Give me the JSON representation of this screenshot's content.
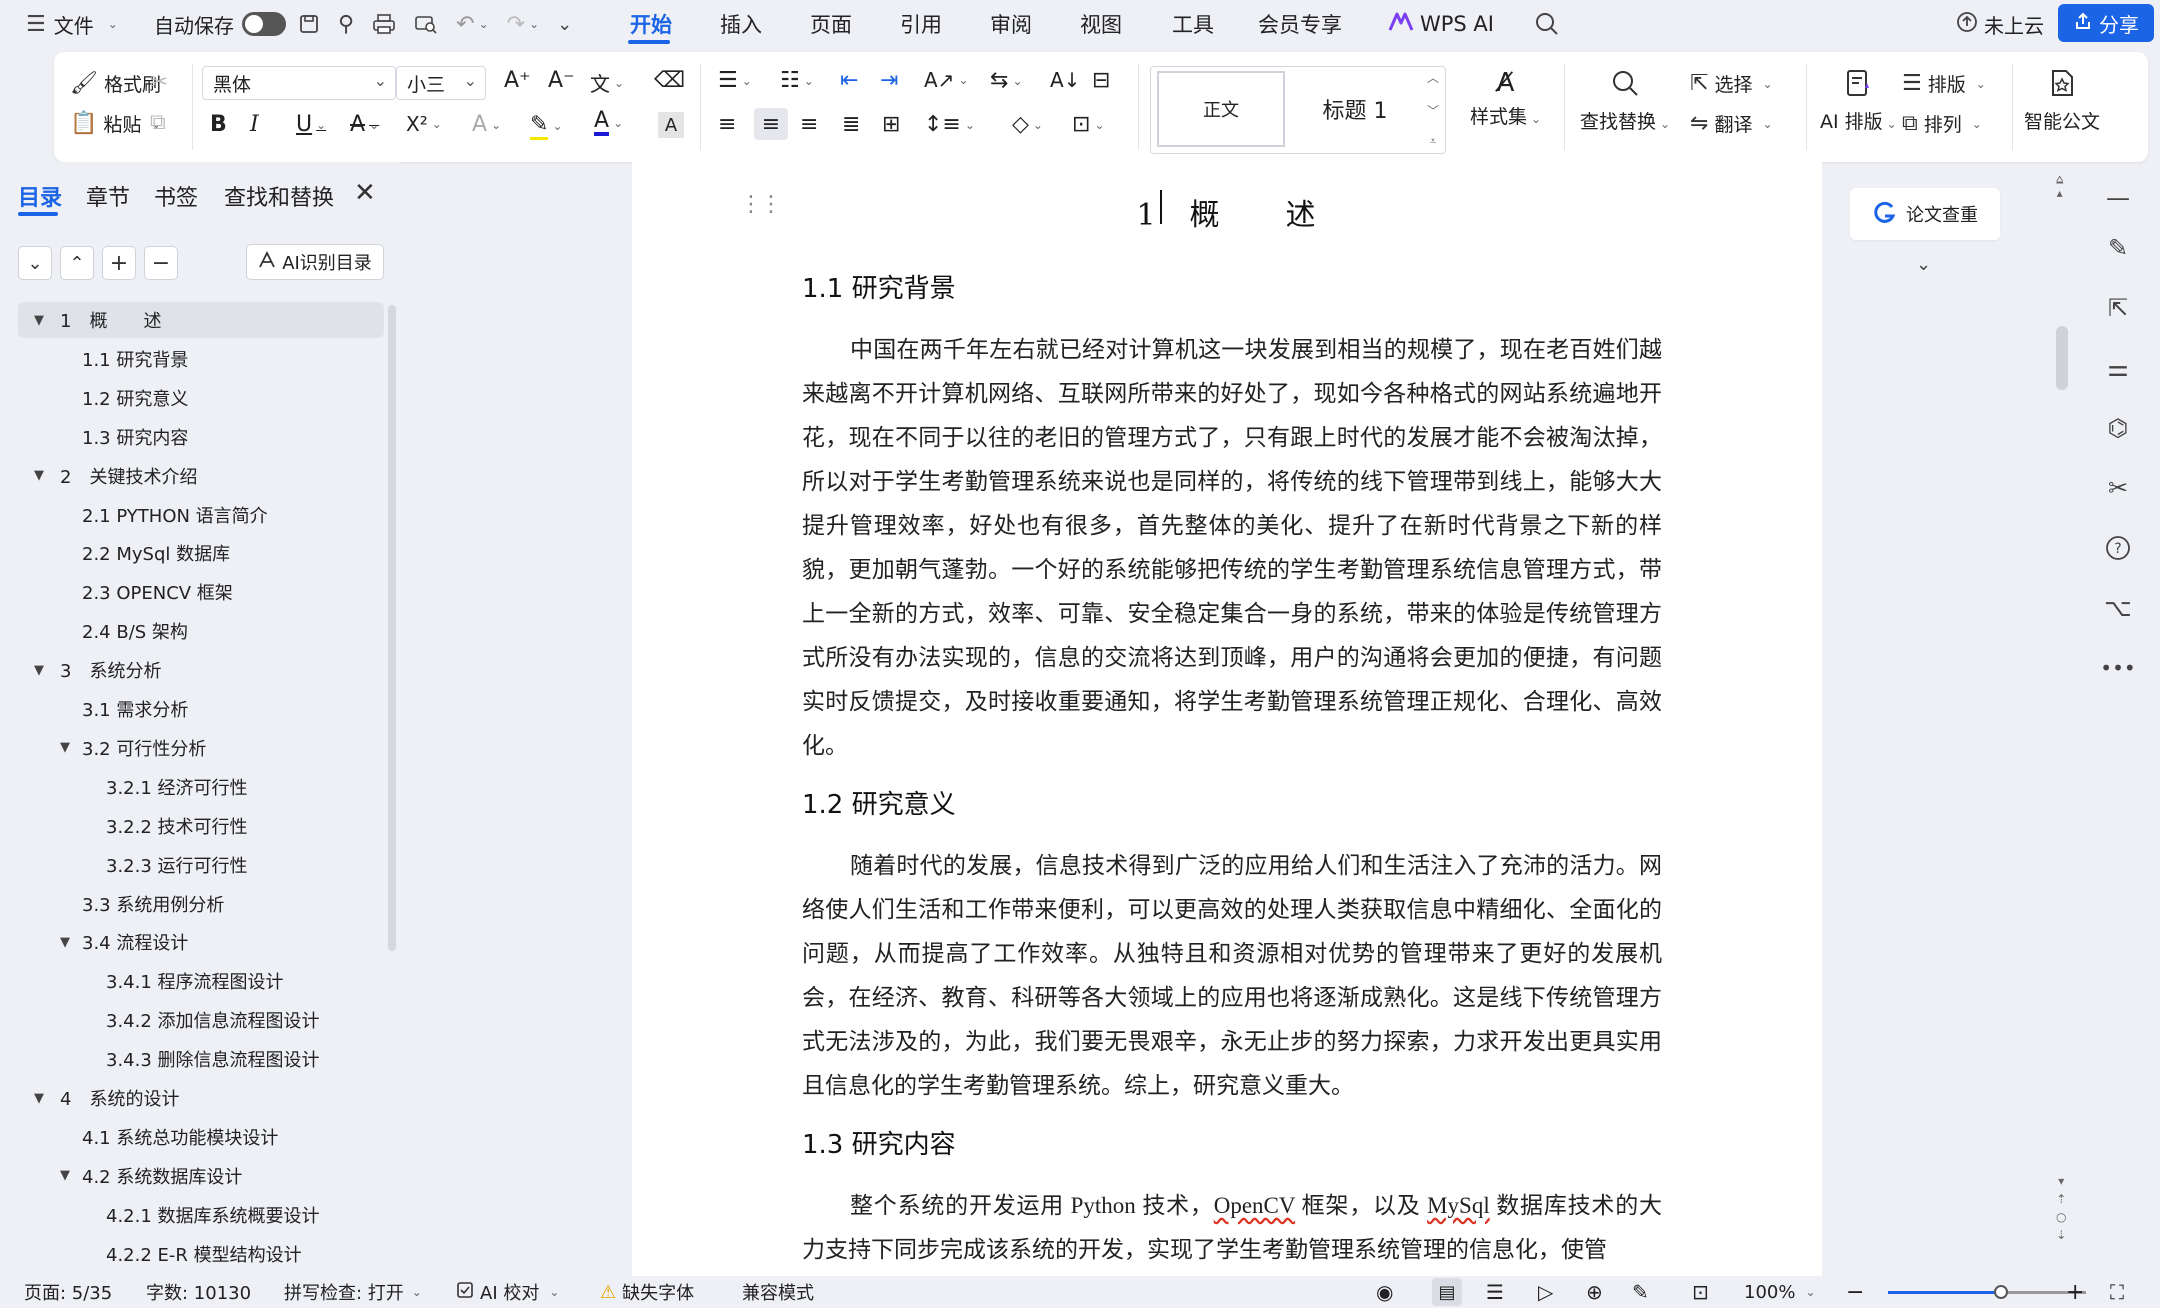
{
  "topbar": {
    "menu_label": "文件",
    "autosave_label": "自动保存",
    "tabs": [
      "开始",
      "插入",
      "页面",
      "引用",
      "审阅",
      "视图",
      "工具",
      "会员专享",
      "WPS AI"
    ],
    "active_tab_index": 0,
    "cloud_label": "未上云",
    "share_label": "分享"
  },
  "ribbon": {
    "format_painter": "格式刷",
    "paste": "粘贴",
    "font_name": "黑体",
    "font_size": "小三",
    "style_normal": "正文",
    "style_heading": "标题 1",
    "style_set": "样式集",
    "find_replace": "查找替换",
    "select": "选择",
    "translate": "翻译",
    "ai_layout": "AI 排版",
    "layout": "排版",
    "arrange": "排列",
    "smart_doc": "智能公文"
  },
  "nav": {
    "tabs": [
      "目录",
      "章节",
      "书签",
      "查找和替换"
    ],
    "active_tab_index": 0,
    "ai_toc_label": "AI识别目录",
    "toc": [
      {
        "text": "1　概　　述",
        "level": 1,
        "caret": "expanded",
        "selected": true
      },
      {
        "text": "1.1 研究背景",
        "level": 2,
        "caret": "none",
        "selected": false
      },
      {
        "text": "1.2 研究意义",
        "level": 2,
        "caret": "none",
        "selected": false
      },
      {
        "text": "1.3 研究内容",
        "level": 2,
        "caret": "none",
        "selected": false
      },
      {
        "text": "2　关键技术介绍",
        "level": 1,
        "caret": "expanded",
        "selected": false
      },
      {
        "text": "2.1 PYTHON 语言简介",
        "level": 2,
        "caret": "none",
        "selected": false
      },
      {
        "text": "2.2 MySql 数据库",
        "level": 2,
        "caret": "none",
        "selected": false
      },
      {
        "text": "2.3 OPENCV 框架",
        "level": 2,
        "caret": "none",
        "selected": false
      },
      {
        "text": "2.4 B/S 架构",
        "level": 2,
        "caret": "none",
        "selected": false
      },
      {
        "text": "3　系统分析",
        "level": 1,
        "caret": "expanded",
        "selected": false
      },
      {
        "text": "3.1 需求分析",
        "level": 2,
        "caret": "none",
        "selected": false
      },
      {
        "text": "3.2 可行性分析",
        "level": 2,
        "caret": "expanded",
        "selected": false
      },
      {
        "text": "3.2.1 经济可行性",
        "level": 3,
        "caret": "none",
        "selected": false
      },
      {
        "text": "3.2.2 技术可行性",
        "level": 3,
        "caret": "none",
        "selected": false
      },
      {
        "text": "3.2.3 运行可行性",
        "level": 3,
        "caret": "none",
        "selected": false
      },
      {
        "text": "3.3 系统用例分析",
        "level": 2,
        "caret": "none",
        "selected": false
      },
      {
        "text": "3.4 流程设计",
        "level": 2,
        "caret": "expanded",
        "selected": false
      },
      {
        "text": "3.4.1 程序流程图设计",
        "level": 3,
        "caret": "none",
        "selected": false
      },
      {
        "text": "3.4.2 添加信息流程图设计",
        "level": 3,
        "caret": "none",
        "selected": false
      },
      {
        "text": "3.4.3 删除信息流程图设计",
        "level": 3,
        "caret": "none",
        "selected": false
      },
      {
        "text": "4　系统的设计",
        "level": 1,
        "caret": "expanded",
        "selected": false
      },
      {
        "text": "4.1 系统总功能模块设计",
        "level": 2,
        "caret": "none",
        "selected": false
      },
      {
        "text": "4.2 系统数据库设计",
        "level": 2,
        "caret": "expanded",
        "selected": false
      },
      {
        "text": "4.2.1 数据库系统概要设计",
        "level": 3,
        "caret": "none",
        "selected": false
      },
      {
        "text": "4.2.2 E-R 模型结构设计",
        "level": 3,
        "caret": "none",
        "selected": false
      }
    ]
  },
  "document": {
    "title": "1　概　　述",
    "sections": [
      {
        "heading": "1.1 研究背景",
        "paragraph": "中国在两千年左右就已经对计算机这一块发展到相当的规模了，现在老百姓们越来越离不开计算机网络、互联网所带来的好处了，现如今各种格式的网站系统遍地开花，现在不同于以往的老旧的管理方式了，只有跟上时代的发展才能不会被淘汰掉，所以对于学生考勤管理系统来说也是同样的，将传统的线下管理带到线上，能够大大提升管理效率，好处也有很多，首先整体的美化、提升了在新时代背景之下新的样貌，更加朝气蓬勃。一个好的系统能够把传统的学生考勤管理系统信息管理方式，带上一全新的方式，效率、可靠、安全稳定集合一身的系统，带来的体验是传统管理方式所没有办法实现的，信息的交流将达到顶峰，用户的沟通将会更加的便捷，有问题实时反馈提交，及时接收重要通知，将学生考勤管理系统管理正规化、合理化、高效化。"
      },
      {
        "heading": "1.2 研究意义",
        "paragraph": "随着时代的发展，信息技术得到广泛的应用给人们和生活注入了充沛的活力。网络使人们生活和工作带来便利，可以更高效的处理人类获取信息中精细化、全面化的问题，从而提高了工作效率。从独特且和资源相对优势的管理带来了更好的发展机会，在经济、教育、科研等各大领域上的应用也将逐渐成熟化。这是线下传统管理方式无法涉及的，为此，我们要无畏艰辛，永无止步的努力探索，力求开发出更具实用且信息化的学生考勤管理系统。综上，研究意义重大。"
      },
      {
        "heading": "1.3 研究内容",
        "paragraph_parts": [
          "整个系统的开发运用 Python 技术，",
          "OpenCV",
          " 框架，以及 ",
          "MySql",
          " 数据库技术的大力支持下同步完成该系统的开发，实现了学生考勤管理系统管理的信息化，使管"
        ]
      }
    ]
  },
  "right_panel": {
    "paper_check_label": "论文查重"
  },
  "statusbar": {
    "page": "页面: 5/35",
    "words": "字数: 10130",
    "spellcheck": "拼写检查: 打开",
    "ai_proof": "AI 校对",
    "missing_font": "缺失字体",
    "compat_mode": "兼容模式",
    "zoom": "100%",
    "zoom_fraction": 0.57
  },
  "colors": {
    "accent": "#1c64e6",
    "background": "#eef0f5",
    "page": "#ffffff"
  }
}
